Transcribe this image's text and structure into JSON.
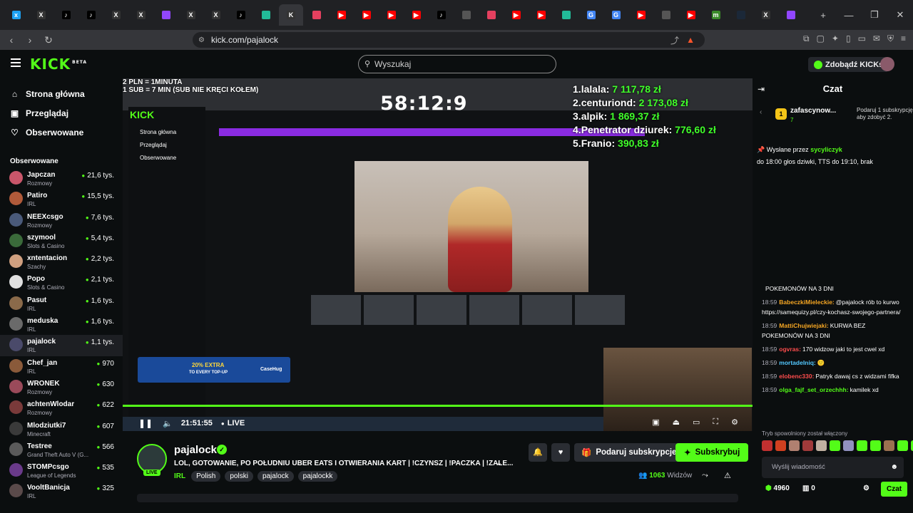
{
  "browser": {
    "tabs": [
      {
        "c": "#1da1f2",
        "g": "x"
      },
      {
        "c": "#333",
        "g": "X"
      },
      {
        "c": "#000",
        "g": "♪"
      },
      {
        "c": "#000",
        "g": "♪"
      },
      {
        "c": "#333",
        "g": "X"
      },
      {
        "c": "#333",
        "g": "X"
      },
      {
        "c": "#9146ff",
        "g": ""
      },
      {
        "c": "#333",
        "g": "X"
      },
      {
        "c": "#333",
        "g": "X"
      },
      {
        "c": "#000",
        "g": "♪"
      },
      {
        "c": "#2b9",
        "g": ""
      },
      {
        "c": "#333",
        "g": "K"
      },
      {
        "c": "#e4405f",
        "g": ""
      },
      {
        "c": "#f00",
        "g": "▶"
      },
      {
        "c": "#f00",
        "g": "▶"
      },
      {
        "c": "#f00",
        "g": "▶"
      },
      {
        "c": "#f00",
        "g": "▶"
      },
      {
        "c": "#000",
        "g": "♪"
      },
      {
        "c": "#555",
        "g": ""
      },
      {
        "c": "#e4405f",
        "g": ""
      },
      {
        "c": "#f00",
        "g": "▶"
      },
      {
        "c": "#f00",
        "g": "▶"
      },
      {
        "c": "#2b9",
        "g": ""
      },
      {
        "c": "#4285f4",
        "g": "G"
      },
      {
        "c": "#4285f4",
        "g": "G"
      },
      {
        "c": "#f00",
        "g": "▶"
      },
      {
        "c": "#555",
        "g": ""
      },
      {
        "c": "#f00",
        "g": "▶"
      },
      {
        "c": "#3a8a2a",
        "g": "m"
      },
      {
        "c": "#1b2838",
        "g": ""
      },
      {
        "c": "#333",
        "g": "X"
      },
      {
        "c": "#9146ff",
        "g": ""
      }
    ],
    "url": "kick.com/pajalock"
  },
  "header": {
    "logo": "KICK",
    "logo_beta": "BETA",
    "search_placeholder": "Wyszukaj",
    "get_kicks": "Zdobądź KICKs"
  },
  "sidebar": {
    "nav": [
      {
        "icon": "⌂",
        "label": "Strona główna"
      },
      {
        "icon": "▣",
        "label": "Przeglądaj"
      },
      {
        "icon": "♡",
        "label": "Obserwowane"
      }
    ],
    "followed_title": "Obserwowane",
    "followed": [
      {
        "name": "Japczan",
        "cat": "Rozmowy",
        "views": "21,6 tys.",
        "color": "#c9566a"
      },
      {
        "name": "Patiro",
        "cat": "IRL",
        "views": "15,5 tys.",
        "color": "#b05a3a"
      },
      {
        "name": "NEEXcsgo",
        "cat": "Rozmowy",
        "views": "7,6 tys.",
        "color": "#4a5a7a"
      },
      {
        "name": "szymool",
        "cat": "Slots & Casino",
        "views": "5,4 tys.",
        "color": "#3a6a3a"
      },
      {
        "name": "xntentacion",
        "cat": "Szachy",
        "views": "2,2 tys.",
        "color": "#d0a080"
      },
      {
        "name": "Popo",
        "cat": "Slots & Casino",
        "views": "2,1 tys.",
        "color": "#e0e0e0"
      },
      {
        "name": "Pasut",
        "cat": "IRL",
        "views": "1,6 tys.",
        "color": "#8a6a4a"
      },
      {
        "name": "meduska",
        "cat": "IRL",
        "views": "1,6 tys.",
        "color": "#6a6a6a"
      },
      {
        "name": "pajalock",
        "cat": "IRL",
        "views": "1,1 tys.",
        "color": "#4a4a6a"
      },
      {
        "name": "Chef_jan",
        "cat": "IRL",
        "views": "970",
        "color": "#8a5a3a"
      },
      {
        "name": "WRONEK",
        "cat": "Rozmowy",
        "views": "630",
        "color": "#9a4a5a"
      },
      {
        "name": "achtenWlodar",
        "cat": "Rozmowy",
        "views": "622",
        "color": "#7a3a3a"
      },
      {
        "name": "Mlodziutki7",
        "cat": "Minecraft",
        "views": "607",
        "color": "#3a3a3a"
      },
      {
        "name": "Testree",
        "cat": "Grand Theft Auto V (G...",
        "views": "566",
        "color": "#5a5a5a"
      },
      {
        "name": "STOMPcsgo",
        "cat": "League of Legends",
        "views": "535",
        "color": "#6a3a8a"
      },
      {
        "name": "VooltBanicja",
        "cat": "IRL",
        "views": "325",
        "color": "#5a4a4a"
      }
    ]
  },
  "video": {
    "overlay_line1": "2 PLN = 1MINUTA",
    "overlay_line2": "1 SUB = 7 MIN (SUB NIE KRĘCI KOŁEM)",
    "timer": "58:12:9",
    "donors": [
      {
        "rank": "1.",
        "name": "lalala:",
        "amount": "7 117,78 zł"
      },
      {
        "rank": "2.",
        "name": "centuriond:",
        "amount": "2 173,08 zł"
      },
      {
        "rank": "3.",
        "name": "alpik:",
        "amount": "1 869,37 zł"
      },
      {
        "rank": "4.",
        "name": "Penetrator dziurek:",
        "amount": "776,60 zł"
      },
      {
        "rank": "5.",
        "name": "Franio:",
        "amount": "390,83 zł"
      }
    ],
    "inner_nav": [
      "Strona główna",
      "Przeglądaj",
      "Obserwowane"
    ],
    "ad_text1": "20% EXTRA",
    "ad_text2": "TO EVERY TOP-UP",
    "ad_brand": "CaseHug",
    "time": "21:51:55",
    "live": "LIVE"
  },
  "channel": {
    "name": "pajalock",
    "live_badge": "LIVE",
    "title": "LOL, GOTOWANIE, PO POŁUDNIU UBER EATS I OTWIERANIA KART | !CZYNSZ | !PACZKA | !ZALE...",
    "category": "IRL",
    "tags": [
      "Polish",
      "polski",
      "pajalock",
      "pajalockk"
    ],
    "gift_label": "Podaruj subskrypcje",
    "subscribe_label": "Subskrybuj",
    "viewers_count": "1063",
    "viewers_label": "Widzów"
  },
  "chat": {
    "title": "Czat",
    "gift_user": "zafascynow...",
    "gift_count": "7",
    "gift_text": "Podaruj 1 subskrypcję, aby zdobyć 2.",
    "pinned_by_label": "Wysłane przez",
    "pinned_by": "sycyliczyk",
    "pinned_text": "do 18:00 głos dziwki, TTS do 19:10, brak",
    "messages": [
      {
        "time": "",
        "user": "",
        "color": "#fff",
        "text": "POKEMONÓW NA 3 DNI"
      },
      {
        "time": "18:59",
        "user": "BabeczkiMieleckie:",
        "color": "#f5a623",
        "text": "@pajalock rób to kurwo https://samequizy.pl/czy-kochasz-swojego-partnera/"
      },
      {
        "time": "18:59",
        "user": "MattiChujwiejaki:",
        "color": "#f5a623",
        "text": "KURWA BEZ POKEMONÓW NA 3 DNI"
      },
      {
        "time": "18:59",
        "user": "ogvras:",
        "color": "#ff4d4d",
        "text": "170 widzow jaki to jest cwel xd"
      },
      {
        "time": "18:59",
        "user": "mortadelniq:",
        "color": "#53c8ff",
        "text": "🙂"
      },
      {
        "time": "18:59",
        "user": "elobenc330:",
        "color": "#ff4d4d",
        "text": "Patryk dawaj cs z widzami fifka"
      },
      {
        "time": "18:59",
        "user": "olga_fajf_set_orzechhh:",
        "color": "#53fc18",
        "text": "kamilek xd"
      }
    ],
    "slow_mode": "Tryb spowolniony został włączony",
    "input_placeholder": "Wyślij wiadomość",
    "points": "4960",
    "box_count": "0",
    "send_label": "Czat"
  }
}
